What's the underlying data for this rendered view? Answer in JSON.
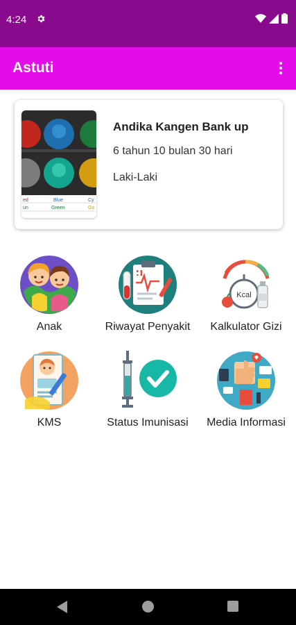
{
  "status_bar": {
    "time": "4:24"
  },
  "app_bar": {
    "title": "Astuti"
  },
  "profile": {
    "name": "Andika Kangen Bank up",
    "age": "6 tahun 10 bulan 30 hari",
    "gender": "Laki-Laki",
    "image_labels": [
      "ed",
      "Blue",
      "Cy",
      "un",
      "Green",
      "Go"
    ]
  },
  "menu": {
    "items": [
      {
        "label": "Anak",
        "icon": "children-icon"
      },
      {
        "label": "Riwayat Penyakit",
        "icon": "medical-record-icon"
      },
      {
        "label": "Kalkulator Gizi",
        "icon": "nutrition-calculator-icon"
      },
      {
        "label": "KMS",
        "icon": "growth-card-icon"
      },
      {
        "label": "Status Imunisasi",
        "icon": "immunization-icon"
      },
      {
        "label": "Media Informasi",
        "icon": "information-media-icon"
      }
    ]
  },
  "colors": {
    "status_bar": "#8a0a8e",
    "app_bar": "#e40ce9",
    "nav_bar": "#000000"
  }
}
